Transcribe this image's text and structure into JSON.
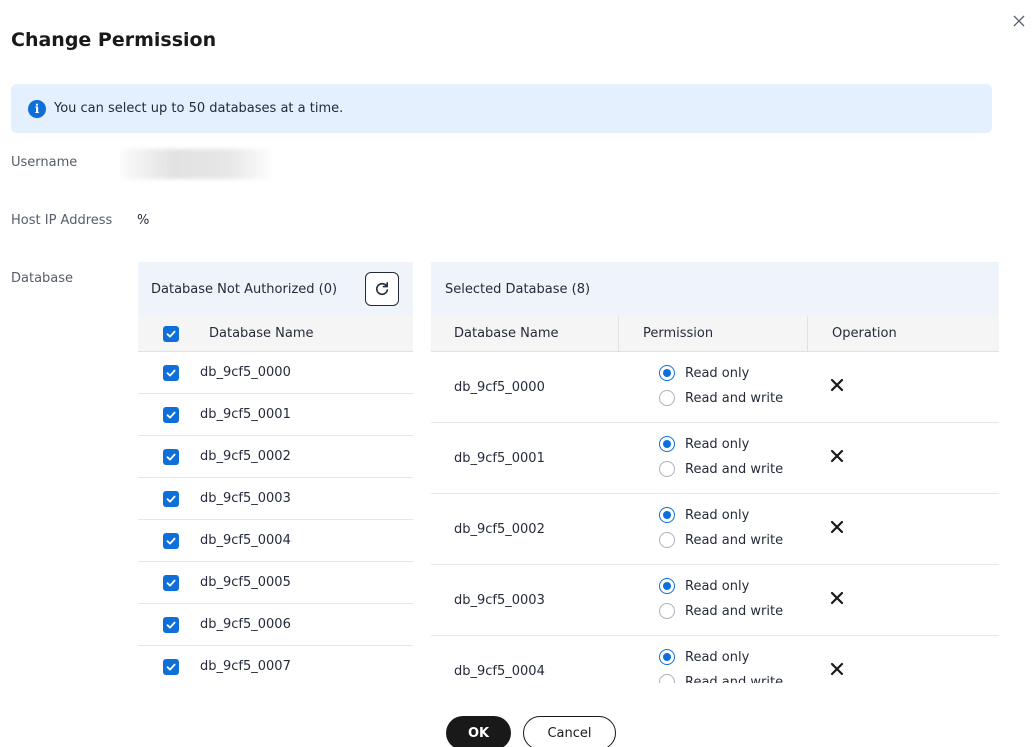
{
  "dialog": {
    "title": "Change Permission",
    "notice": "You can select up to 50 databases at a time."
  },
  "form": {
    "username_label": "Username",
    "host_label": "Host IP Address",
    "host_value": "%",
    "database_label": "Database"
  },
  "left_table": {
    "header": "Database Not Authorized (0)",
    "column": "Database Name",
    "rows": [
      {
        "name": "db_9cf5_0000",
        "checked": true
      },
      {
        "name": "db_9cf5_0001",
        "checked": true
      },
      {
        "name": "db_9cf5_0002",
        "checked": true
      },
      {
        "name": "db_9cf5_0003",
        "checked": true
      },
      {
        "name": "db_9cf5_0004",
        "checked": true
      },
      {
        "name": "db_9cf5_0005",
        "checked": true
      },
      {
        "name": "db_9cf5_0006",
        "checked": true
      },
      {
        "name": "db_9cf5_0007",
        "checked": true
      }
    ]
  },
  "right_table": {
    "header": "Selected Database (8)",
    "columns": [
      "Database Name",
      "Permission",
      "Operation"
    ],
    "option_read_only": "Read only",
    "option_read_write": "Read and write",
    "rows": [
      {
        "name": "db_9cf5_0000",
        "permission": "Read only"
      },
      {
        "name": "db_9cf5_0001",
        "permission": "Read only"
      },
      {
        "name": "db_9cf5_0002",
        "permission": "Read only"
      },
      {
        "name": "db_9cf5_0003",
        "permission": "Read only"
      },
      {
        "name": "db_9cf5_0004",
        "permission": "Read only"
      }
    ]
  },
  "buttons": {
    "ok": "OK",
    "cancel": "Cancel"
  },
  "colors": {
    "accent": "#0f6fd8",
    "notice_bg": "#e4f0fd",
    "table_header_bg": "#eff4fb",
    "primary_button": "#191919"
  }
}
